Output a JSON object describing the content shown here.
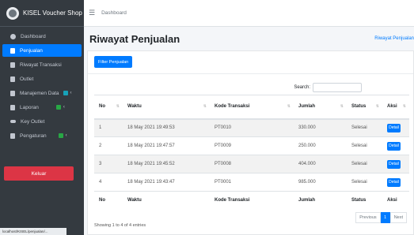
{
  "brand": {
    "name": "KISEL Voucher Shop"
  },
  "sidebar": {
    "items": [
      {
        "label": "Dashboard",
        "icon": "dashboard-icon"
      },
      {
        "label": "Penjualan",
        "icon": "document-icon",
        "active": true
      },
      {
        "label": "Riwayat Transaksi",
        "icon": "document-icon"
      },
      {
        "label": "Outlet",
        "icon": "document-icon"
      },
      {
        "label": "Manajemen Data",
        "icon": "book-icon",
        "badge_color": "#17a2b8"
      },
      {
        "label": "Laporan",
        "icon": "book-icon",
        "badge_color": "#28a745"
      },
      {
        "label": "Key Outlet",
        "icon": "key-icon"
      },
      {
        "label": "Pengaturan",
        "icon": "book-icon",
        "badge_color": "#28a745"
      }
    ],
    "logout_label": "Keluar",
    "footer_text": "localhost/KISEL/penjualan/..."
  },
  "topbar": {
    "menu_icon": "hamburger-icon",
    "link": "Dashboard"
  },
  "page": {
    "title": "Riwayat Penjualan",
    "breadcrumb": "Riwayat Penjualan"
  },
  "filter_button": "Filter Penjualan",
  "search": {
    "label": "Search:",
    "value": ""
  },
  "table": {
    "headers": [
      "No",
      "Waktu",
      "Kode Transaksi",
      "Jumlah",
      "Status",
      "Aksi"
    ],
    "rows": [
      {
        "no": "1",
        "waktu": "18 May 2021 19:49:53",
        "kode": "PT0010",
        "jumlah": "330.000",
        "status": "Selesai",
        "aksi": "Detail"
      },
      {
        "no": "2",
        "waktu": "18 May 2021 19:47:57",
        "kode": "PT0009",
        "jumlah": "250.000",
        "status": "Selesai",
        "aksi": "Detail"
      },
      {
        "no": "3",
        "waktu": "18 May 2021 19:45:52",
        "kode": "PT0008",
        "jumlah": "404.000",
        "status": "Selesai",
        "aksi": "Detail"
      },
      {
        "no": "4",
        "waktu": "18 May 2021 19:43:47",
        "kode": "PT0001",
        "jumlah": "985.000",
        "status": "Selesai",
        "aksi": "Detail"
      }
    ],
    "info": "Showing 1 to 4 of 4 entries"
  },
  "pagination": {
    "previous": "Previous",
    "current": "1",
    "next": "Next"
  },
  "colors": {
    "accent": "#007bff",
    "sidebar_bg": "#343a40",
    "logout": "#dc3545"
  }
}
